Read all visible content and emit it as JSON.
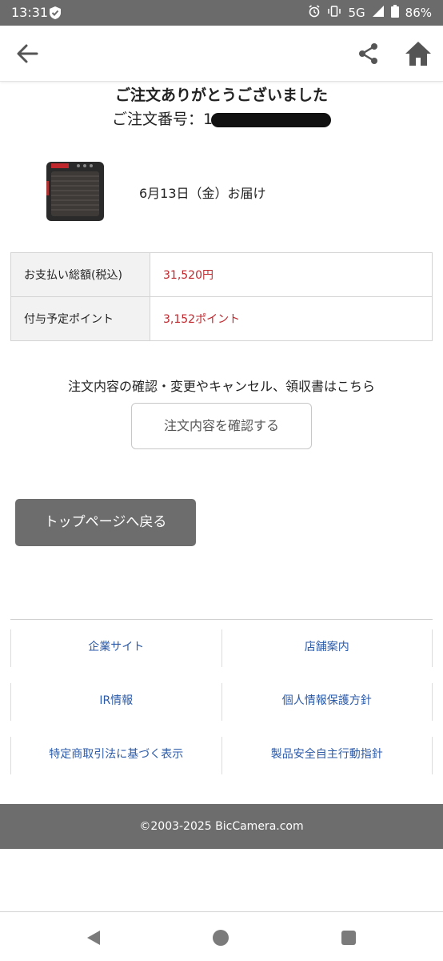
{
  "status_bar": {
    "time": "13:31",
    "network": "5G",
    "battery": "86%",
    "icons": [
      "shield-check-icon",
      "alarm-icon",
      "vibrate-icon",
      "signal-icon",
      "battery-icon"
    ]
  },
  "app_bar": {
    "icons": [
      "back-arrow-icon",
      "share-icon",
      "home-icon"
    ]
  },
  "order": {
    "thanks": "ご注文ありがとうございました",
    "number_label": "ご注文番号：1",
    "delivery": "6月13日（金）お届け"
  },
  "summary": [
    {
      "label": "お支払い総額(税込)",
      "value": "31,520円"
    },
    {
      "label": "付与予定ポイント",
      "value": "3,152ポイント"
    }
  ],
  "confirm": {
    "notice": "注文内容の確認・変更やキャンセル、領収書はこちら",
    "button": "注文内容を確認する"
  },
  "top_button": "トップページへ戻る",
  "footer_links": [
    [
      "企業サイト",
      "店舗案内"
    ],
    [
      "IR情報",
      "個人情報保護方針"
    ],
    [
      "特定商取引法に基づく表示",
      "製品安全自主行動指針"
    ]
  ],
  "copyright": "©2003-2025 BicCamera.com",
  "colors": {
    "price_red": "#c0272d",
    "link_blue": "#2b5aa8",
    "button_gray": "#6d6d6d"
  }
}
